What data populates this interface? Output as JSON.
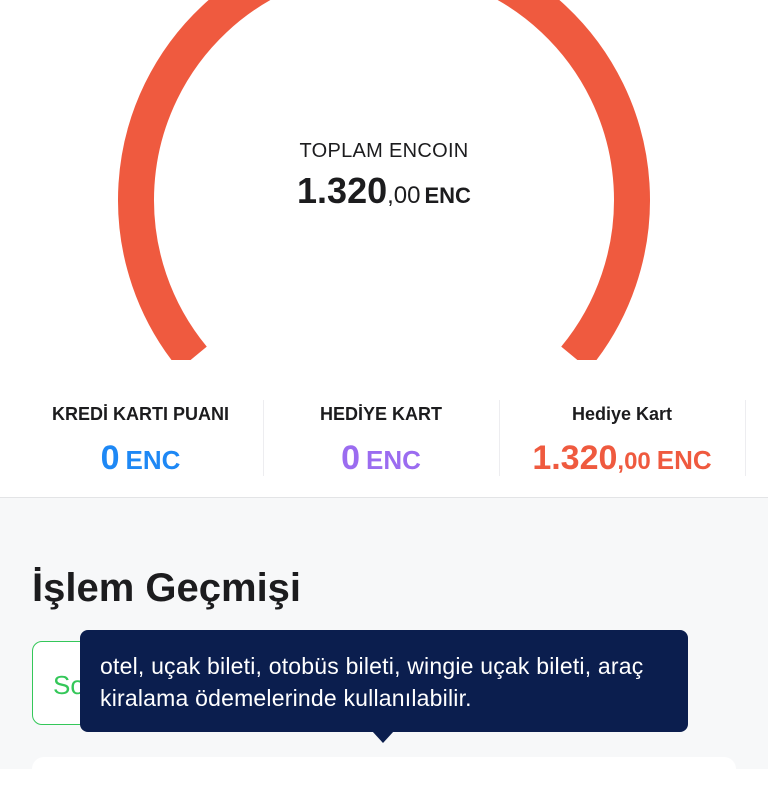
{
  "total": {
    "label": "TOPLAM ENCOIN",
    "int": "1.320",
    "dec": ",00",
    "unit": "ENC",
    "progress_fraction": 0.72,
    "color": "#ef5a3f"
  },
  "stats": [
    {
      "label": "KREDİ KARTI PUANI",
      "int": "0",
      "dec": "",
      "unit": "ENC",
      "color": "#1e88f5"
    },
    {
      "label": "HEDİYE KART",
      "int": "0",
      "dec": "",
      "unit": "ENC",
      "color": "#9b6cf0"
    },
    {
      "label": "Hediye Kart",
      "int": "1.320",
      "dec": ",00",
      "unit": "ENC",
      "color": "#ef5a3f"
    }
  ],
  "history": {
    "title": "İşlem Geçmişi",
    "filter_label": "So",
    "filter_color": "#34c759"
  },
  "tooltip": {
    "text": "otel, uçak bileti, otobüs bileti, wingie uçak bileti, araç kiralama  ödemelerinde kullanılabilir.",
    "bg_color": "#0b1e4e"
  }
}
